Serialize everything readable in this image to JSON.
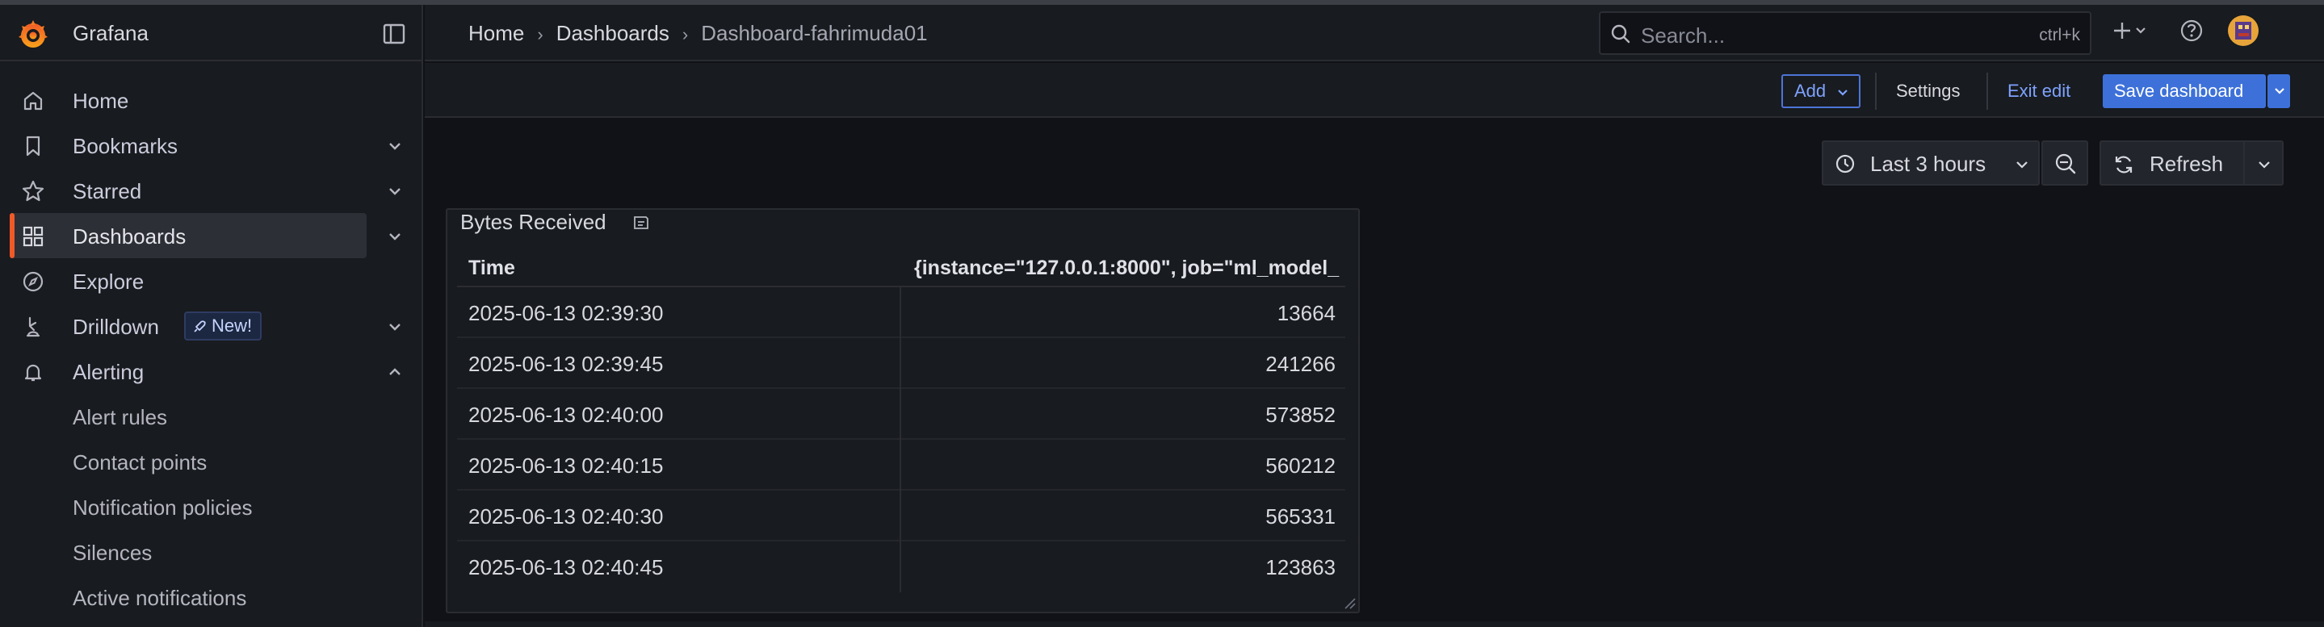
{
  "app": {
    "name": "Grafana"
  },
  "sidebar": {
    "items": [
      {
        "label": "Home",
        "icon": "home-icon"
      },
      {
        "label": "Bookmarks",
        "icon": "bookmark-icon"
      },
      {
        "label": "Starred",
        "icon": "star-icon"
      },
      {
        "label": "Dashboards",
        "icon": "apps-icon"
      },
      {
        "label": "Explore",
        "icon": "compass-icon"
      },
      {
        "label": "Drilldown",
        "icon": "drilldown-icon",
        "badge": "New!"
      },
      {
        "label": "Alerting",
        "icon": "bell-icon"
      }
    ],
    "alerting_children": [
      "Alert rules",
      "Contact points",
      "Notification policies",
      "Silences",
      "Active notifications"
    ]
  },
  "header": {
    "breadcrumbs": [
      "Home",
      "Dashboards",
      "Dashboard-fahrimuda01"
    ],
    "search": {
      "placeholder": "Search...",
      "shortcut": "ctrl+k"
    }
  },
  "toolbar": {
    "add_label": "Add",
    "settings_label": "Settings",
    "exit_label": "Exit edit",
    "save_label": "Save dashboard"
  },
  "time_controls": {
    "range_label": "Last 3 hours",
    "refresh_label": "Refresh"
  },
  "panel": {
    "title": "Bytes Received",
    "columns": [
      "Time",
      "{instance=\"127.0.0.1:8000\", job=\"ml_model_"
    ],
    "rows": [
      {
        "time": "2025-06-13 02:39:30",
        "value": "13664"
      },
      {
        "time": "2025-06-13 02:39:45",
        "value": "241266"
      },
      {
        "time": "2025-06-13 02:40:00",
        "value": "573852"
      },
      {
        "time": "2025-06-13 02:40:15",
        "value": "560212"
      },
      {
        "time": "2025-06-13 02:40:30",
        "value": "565331"
      },
      {
        "time": "2025-06-13 02:40:45",
        "value": "123863"
      }
    ]
  },
  "colors": {
    "accent": "#f05a28",
    "primary": "#3d71d9",
    "link": "#7ea2ff",
    "background": "#111217",
    "panel": "#181b1f"
  }
}
